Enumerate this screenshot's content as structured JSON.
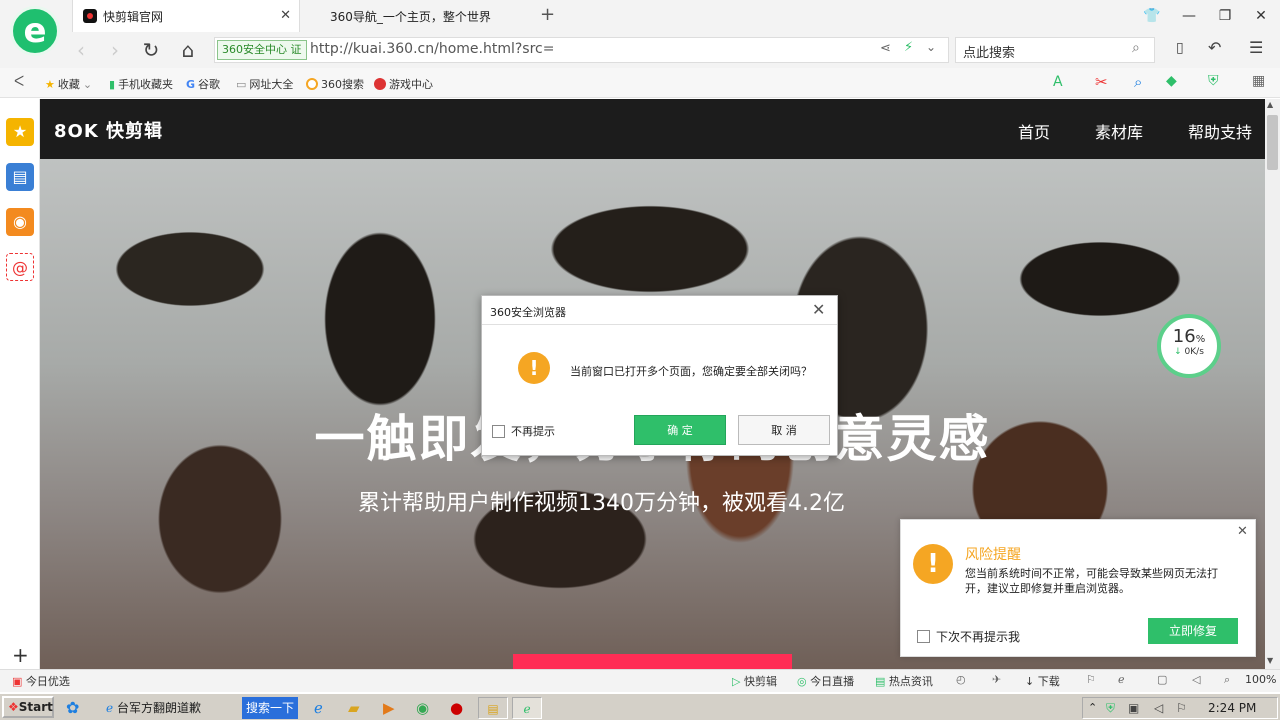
{
  "tabs": [
    {
      "title": "快剪辑官网",
      "close": "✕"
    },
    {
      "title": "360导航_一个主页，整个世界"
    }
  ],
  "new_tab": "+",
  "window": {
    "restore_skin": "👕",
    "minimize": "—",
    "maximize": "❐",
    "close": "✕"
  },
  "nav": {
    "back": "‹",
    "forward": "›",
    "reload": "↻",
    "home": "⌂"
  },
  "address": {
    "security_badge": "360安全中心 证",
    "url": "http://kuai.360.cn/home.html?src="
  },
  "search": {
    "placeholder": "点此搜索"
  },
  "bookmarks": [
    {
      "label": "收藏"
    },
    {
      "label": "手机收藏夹"
    },
    {
      "label": "谷歌"
    },
    {
      "label": "网址大全"
    },
    {
      "label": "360搜索"
    },
    {
      "label": "游戏中心"
    }
  ],
  "site": {
    "logo": "8OK 快剪辑",
    "nav": [
      "首页",
      "素材库",
      "帮助支持"
    ],
    "hero_title": "一触即发，分享你的创意灵感",
    "hero_sub": "累计帮助用户制作视频1340万分钟，被观看4.2亿"
  },
  "speed": {
    "percent": "16",
    "unit": "%",
    "rate": "0K/s"
  },
  "dialog": {
    "title": "360安全浏览器",
    "close": "✕",
    "icon": "!",
    "message": "当前窗口已打开多个页面，您确定要全部关闭吗？",
    "checkbox": "不再提示",
    "ok": "确 定",
    "cancel": "取 消"
  },
  "risk": {
    "close": "✕",
    "icon": "!",
    "title": "风险提醒",
    "message": "您当前系统时间不正常，可能会导致某些网页无法打开，建议立即修复并重启浏览器。",
    "checkbox": "下次不再提示我",
    "button": "立即修复"
  },
  "status": {
    "left": "今日优选",
    "items": [
      "快剪辑",
      "今日直播",
      "热点资讯",
      "下载"
    ],
    "zoom": "100%"
  },
  "taskbar": {
    "start": "Start",
    "task1": "台军方翻朗道歉",
    "search_btn": "搜索一下",
    "time": "2:24 PM"
  },
  "sidebar": {
    "add": "+"
  }
}
